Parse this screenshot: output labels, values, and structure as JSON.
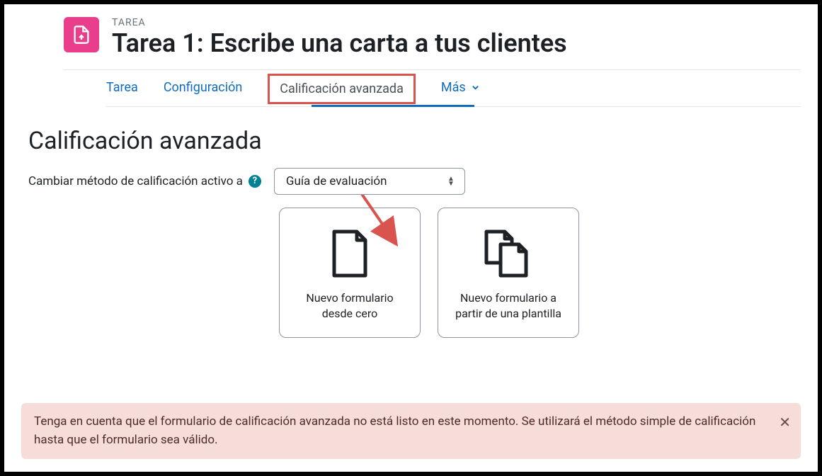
{
  "header": {
    "subline": "TAREA",
    "title": "Tarea 1: Escribe una carta a tus clientes"
  },
  "tabs": {
    "tarea": "Tarea",
    "config": "Configuración",
    "active": "Calificación avanzada",
    "more": "Más"
  },
  "page": {
    "title": "Calificación avanzada",
    "select_label": "Cambiar método de calificación activo a",
    "select_value": "Guía de evaluación"
  },
  "cards": {
    "from_scratch": "Nuevo formulario desde cero",
    "from_template": "Nuevo formulario a partir de una plantilla"
  },
  "alert": {
    "text": "Tenga en cuenta que el formulario de calificación avanzada no está listo en este momento. Se utilizará el método simple de calificación hasta que el formulario sea válido."
  }
}
